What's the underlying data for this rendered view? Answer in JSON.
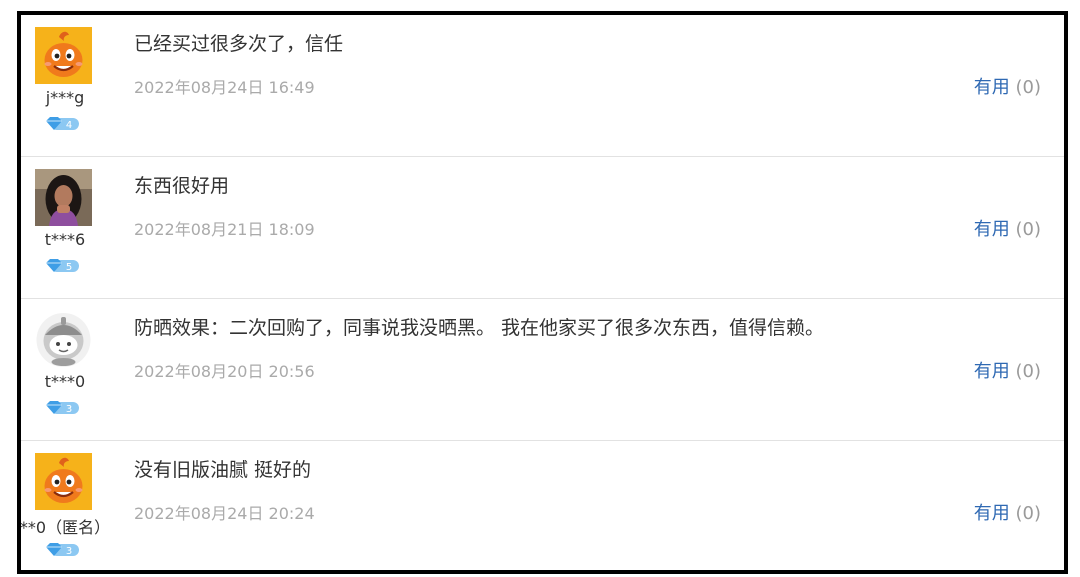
{
  "reviews": [
    {
      "username": "j***g",
      "avatar": "orange-mascot-avatar",
      "level": "4",
      "content": "已经买过很多次了，信任",
      "date": "2022年08月24日 16:49",
      "useful_label": "有用",
      "useful_count": "(0)"
    },
    {
      "username": "t***6",
      "avatar": "photo-avatar",
      "level": "5",
      "content": "东西很好用",
      "date": "2022年08月21日 18:09",
      "useful_label": "有用",
      "useful_count": "(0)"
    },
    {
      "username": "t***0",
      "avatar": "gray-robot-avatar",
      "level": "3",
      "content": "防晒效果：二次回购了，同事说我没晒黑。 我在他家买了很多次东西，值得信赖。",
      "date": "2022年08月20日 20:56",
      "useful_label": "有用",
      "useful_count": "(0)"
    },
    {
      "username": "**0（匿名）",
      "avatar": "orange-mascot-avatar",
      "level": "3",
      "content": "没有旧版油腻 挺好的",
      "date": "2022年08月24日 20:24",
      "useful_label": "有用",
      "useful_count": "(0)"
    }
  ],
  "colors": {
    "useful_link": "#2f69b3",
    "date_text": "#aaaaaa",
    "level_badge": "#4aa3e8",
    "mascot_orange": "#f07a1c",
    "frame_border": "#000000"
  }
}
